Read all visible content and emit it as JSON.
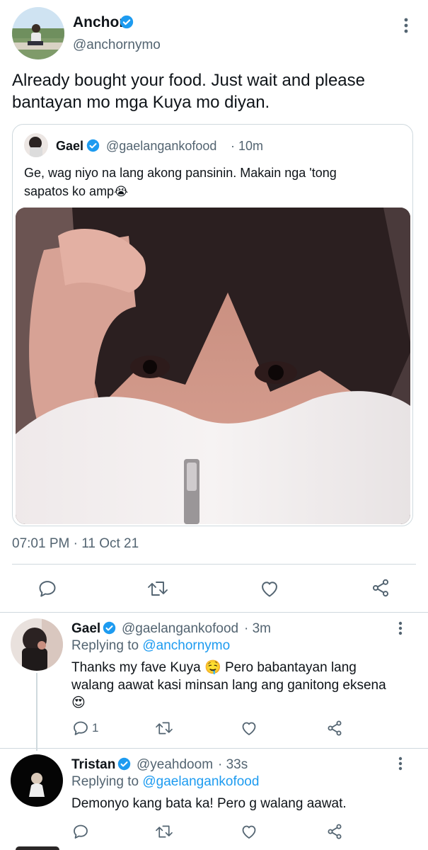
{
  "main_tweet": {
    "author_name": "Anchor",
    "author_handle": "@anchornymo",
    "text": "Already bought your food. Just wait and please bantayan mo mga Kuya mo diyan.",
    "timestamp": "07:01 PM · 11 Oct 21",
    "quoted": {
      "author_name": "Gael",
      "author_handle": "@gaelangankofood",
      "time": "· 10m",
      "text_line1": "Ge, wag niyo na lang akong pansinin. Makain nga 'tong",
      "text_line2": "sapatos ko amp",
      "emoji": "😭"
    }
  },
  "replies": [
    {
      "author_name": "Gael",
      "author_handle": "@gaelangankofood",
      "time": "· 3m",
      "replying_prefix": "Replying to",
      "replying_to": "@anchornymo",
      "text_a": "Thanks my fave Kuya",
      "emoji_a": "🤤",
      "text_b": "Pero babantayan lang",
      "text_c": "walang aawat kasi minsan lang ang ganitong eksena",
      "emoji_c": "😍",
      "reply_count": "1"
    },
    {
      "author_name": "Tristan",
      "author_handle": "@yeahdoom",
      "time": "· 33s",
      "replying_prefix": "Replying to",
      "replying_to": "@gaelangankofood",
      "text_a": "Demonyo kang bata ka! Pero g walang aawat.",
      "reply_count": ""
    }
  ],
  "colors": {
    "accent": "#1d9bf0",
    "muted": "#536471",
    "divider": "#cfd9de"
  }
}
